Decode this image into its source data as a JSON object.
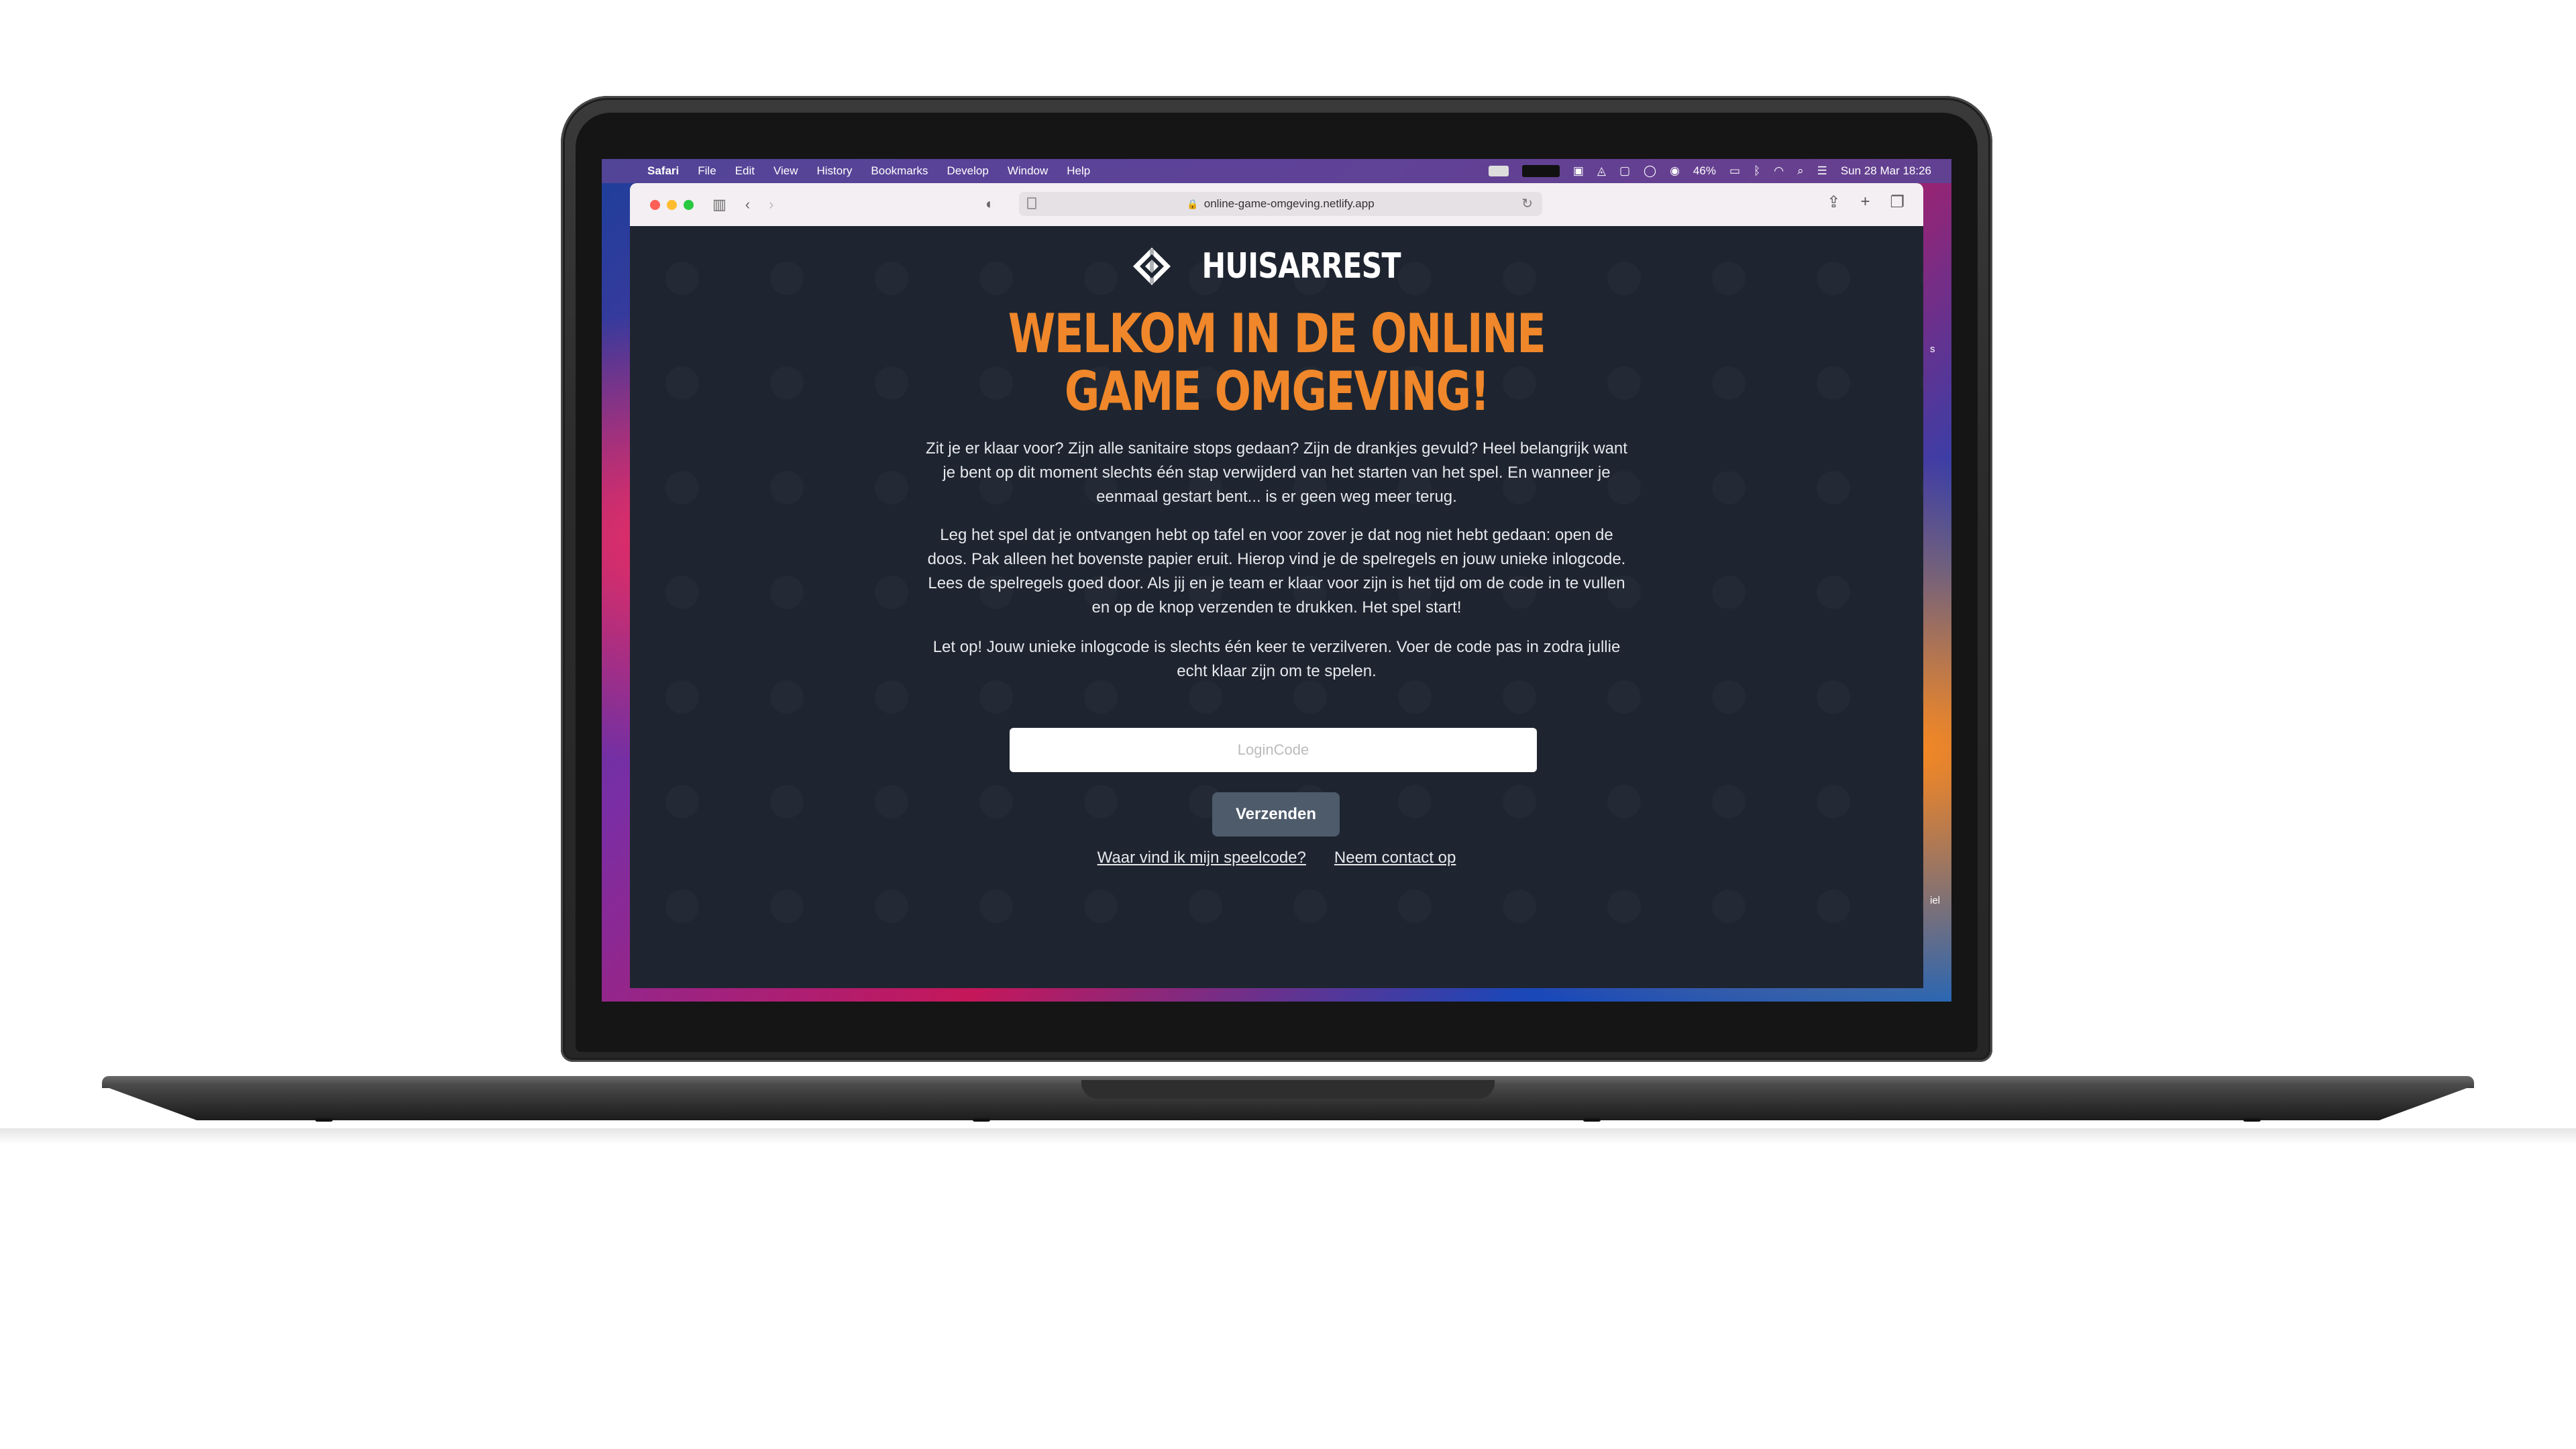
{
  "menubar": {
    "app_name": "Safari",
    "menus": [
      "File",
      "Edit",
      "View",
      "History",
      "Bookmarks",
      "Develop",
      "Window",
      "Help"
    ],
    "battery": "46%",
    "datetime": "Sun 28 Mar  18:26"
  },
  "browser": {
    "url": "online-game-omgeving.netlify.app"
  },
  "page": {
    "logo_text": "HUISARREST",
    "headline_line1": "WELKOM IN DE ONLINE",
    "headline_line2": "GAME OMGEVING!",
    "paragraph1": "Zit je er klaar voor? Zijn alle sanitaire stops gedaan? Zijn de drankjes gevuld? Heel belangrijk want je bent op dit moment slechts één stap verwijderd van het starten van het spel. En wanneer je eenmaal gestart bent... is er geen weg meer terug.",
    "paragraph2": "Leg het spel dat je ontvangen hebt op tafel en voor zover je dat nog niet hebt gedaan: open de doos. Pak alleen het bovenste papier eruit. Hierop vind je de spelregels en jouw unieke inlogcode. Lees de spelregels goed door. Als jij en je team er klaar voor zijn is het tijd om de code in te vullen en op de knop verzenden te drukken. Het spel start!",
    "paragraph3": "Let op! Jouw unieke inlogcode is slechts één keer te verzilveren. Voer de code pas in zodra jullie echt klaar zijn om te spelen.",
    "login_placeholder": "LoginCode",
    "submit_label": "Verzenden",
    "link_find_code": "Waar vind ik mijn speelcode?",
    "link_contact": "Neem contact op"
  },
  "desktop_fragments": {
    "right_edge_text": "iel"
  },
  "colors": {
    "headline": "#f0872a",
    "page_background": "#1e2530",
    "button": "#4e5b6b"
  }
}
